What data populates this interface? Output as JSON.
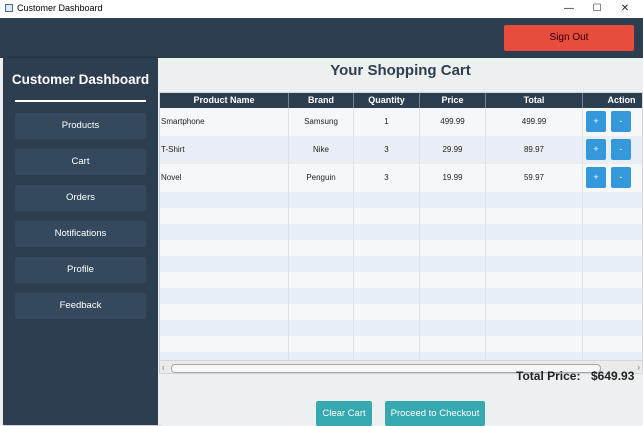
{
  "window": {
    "title": "Customer Dashboard",
    "minimize": "—",
    "maximize": "☐",
    "close": "✕"
  },
  "header": {
    "sign_out": "Sign Out"
  },
  "sidebar": {
    "title": "Customer Dashboard",
    "items": [
      {
        "label": "Products"
      },
      {
        "label": "Cart"
      },
      {
        "label": "Orders"
      },
      {
        "label": "Notifications"
      },
      {
        "label": "Profile"
      },
      {
        "label": "Feedback"
      }
    ]
  },
  "cart": {
    "title": "Your Shopping Cart",
    "columns": [
      "Product Name",
      "Brand",
      "Quantity",
      "Price",
      "Total",
      "Action"
    ],
    "rows": [
      {
        "name": "Smartphone",
        "brand": "Samsung",
        "quantity": "1",
        "price": "499.99",
        "total": "499.99",
        "plus": "+",
        "minus": "-"
      },
      {
        "name": "T-Shirt",
        "brand": "Nike",
        "quantity": "3",
        "price": "29.99",
        "total": "89.97",
        "plus": "+",
        "minus": "-"
      },
      {
        "name": "Novel",
        "brand": "Penguin",
        "quantity": "3",
        "price": "19.99",
        "total": "59.97",
        "plus": "+",
        "minus": "-"
      }
    ],
    "total_label": "Total Price:",
    "total_value": "$649.93",
    "clear_button": "Clear Cart",
    "checkout_button": "Proceed to Checkout"
  },
  "colors": {
    "dark": "#2c3e50",
    "nav_button": "#34495e",
    "sign_out": "#e74c3c",
    "action_button": "#3498db",
    "bottom_button": "#35a8b0"
  }
}
